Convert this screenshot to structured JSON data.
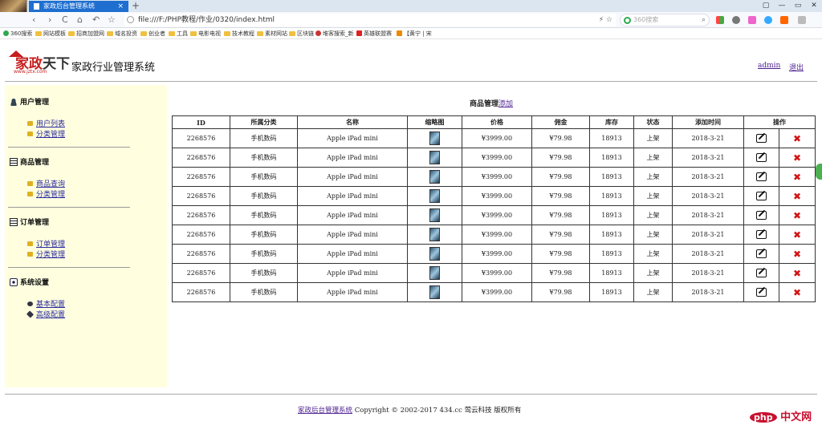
{
  "browser": {
    "tab_title": "家政后台管理系统",
    "tab_close": "×",
    "new_tab": "+",
    "url": "file:///F:/PHP教程/作业/0320/index.html",
    "url_right": "⚡ ☆",
    "search_placeholder": "360搜索",
    "window_controls": [
      "▢",
      "—",
      "▭",
      "✕"
    ],
    "nav": [
      "‹",
      "›",
      "C",
      "⌂",
      "↶",
      "☆"
    ],
    "bookmarks": [
      "360搜索",
      "网站模板",
      "招商加盟网",
      "域名投资",
      "创业者",
      "工具",
      "电影电视",
      "技术教程",
      "素材网站",
      "区块链",
      "堆客搜索_新",
      "英雄联盟赛",
      "【黄宁 | 宋"
    ]
  },
  "header": {
    "logo_text": "家政",
    "logo_text2": "天下",
    "logo_sub": "www.jztx.com",
    "site_title": "家政行业管理系统",
    "user_link": "admin",
    "logout_link": "退出"
  },
  "sidebar": {
    "sections": [
      {
        "title": "用户管理",
        "icon": "user-icon",
        "items": [
          "用户列表",
          "分类管理"
        ]
      },
      {
        "title": "商品管理",
        "icon": "product-icon",
        "items": [
          "商品查询",
          "分类管理"
        ]
      },
      {
        "title": "订单管理",
        "icon": "order-icon",
        "items": [
          "订单管理",
          "分类管理"
        ]
      },
      {
        "title": "系统设置",
        "icon": "settings-icon",
        "items": [
          "基本配置",
          "高级配置"
        ]
      }
    ]
  },
  "main": {
    "title": "商品管理",
    "add_link": "添加",
    "columns": [
      "ID",
      "所属分类",
      "名称",
      "缩略图",
      "价格",
      "佣金",
      "库存",
      "状态",
      "添加时间",
      "操作"
    ],
    "rows": [
      {
        "id": "2268576",
        "category": "手机数码",
        "name": "Apple iPad mini",
        "price": "¥3999.00",
        "commission": "¥79.98",
        "stock": "18913",
        "status": "上架",
        "date": "2018-3-21"
      },
      {
        "id": "2268576",
        "category": "手机数码",
        "name": "Apple iPad mini",
        "price": "¥3999.00",
        "commission": "¥79.98",
        "stock": "18913",
        "status": "上架",
        "date": "2018-3-21"
      },
      {
        "id": "2268576",
        "category": "手机数码",
        "name": "Apple iPad mini",
        "price": "¥3999.00",
        "commission": "¥79.98",
        "stock": "18913",
        "status": "上架",
        "date": "2018-3-21"
      },
      {
        "id": "2268576",
        "category": "手机数码",
        "name": "Apple iPad mini",
        "price": "¥3999.00",
        "commission": "¥79.98",
        "stock": "18913",
        "status": "上架",
        "date": "2018-3-21"
      },
      {
        "id": "2268576",
        "category": "手机数码",
        "name": "Apple iPad mini",
        "price": "¥3999.00",
        "commission": "¥79.98",
        "stock": "18913",
        "status": "上架",
        "date": "2018-3-21"
      },
      {
        "id": "2268576",
        "category": "手机数码",
        "name": "Apple iPad mini",
        "price": "¥3999.00",
        "commission": "¥79.98",
        "stock": "18913",
        "status": "上架",
        "date": "2018-3-21"
      },
      {
        "id": "2268576",
        "category": "手机数码",
        "name": "Apple iPad mini",
        "price": "¥3999.00",
        "commission": "¥79.98",
        "stock": "18913",
        "status": "上架",
        "date": "2018-3-21"
      },
      {
        "id": "2268576",
        "category": "手机数码",
        "name": "Apple iPad mini",
        "price": "¥3999.00",
        "commission": "¥79.98",
        "stock": "18913",
        "status": "上架",
        "date": "2018-3-21"
      },
      {
        "id": "2268576",
        "category": "手机数码",
        "name": "Apple iPad mini",
        "price": "¥3999.00",
        "commission": "¥79.98",
        "stock": "18913",
        "status": "上架",
        "date": "2018-3-21"
      }
    ],
    "delete_glyph": "✖"
  },
  "footer": {
    "link": "家政后台管理系统",
    "copyright": "Copyright © 2002-2017 434.cc 莺云科技 版权所有"
  },
  "watermark": {
    "php": "php",
    "text": "中文网"
  },
  "colors": {
    "sidebar_bg": "#ffffe0",
    "link": "#4c1f8f",
    "delete": "#d01515",
    "logo_red": "#c71d1d",
    "tab_blue": "#1f6fd1"
  }
}
